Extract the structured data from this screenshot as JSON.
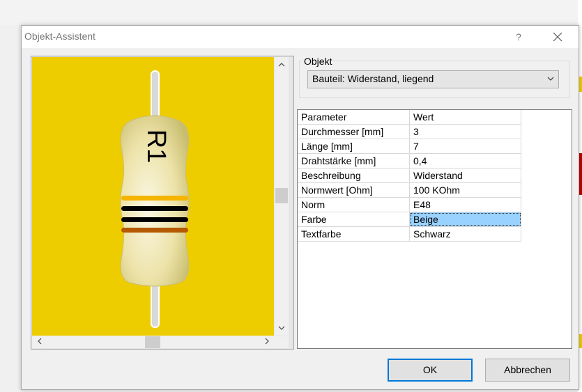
{
  "dialog": {
    "title": "Objekt-Assistent",
    "help_label": "?"
  },
  "preview": {
    "label_text": "R1",
    "body_color": "#f2e9b0",
    "background_color": "#eecd00",
    "band_colors": [
      "#f5b400",
      "#000000",
      "#000000",
      "#b55a00"
    ]
  },
  "objekt": {
    "group_label": "Objekt",
    "selected": "Bauteil: Widerstand, liegend"
  },
  "grid": {
    "header": {
      "param": "Parameter",
      "value": "Wert"
    },
    "rows": [
      {
        "param": "Durchmesser [mm]",
        "value": "3"
      },
      {
        "param": "Länge [mm]",
        "value": "7"
      },
      {
        "param": "Drahtstärke [mm]",
        "value": "0,4"
      },
      {
        "param": "Beschreibung",
        "value": "Widerstand"
      },
      {
        "param": "Normwert [Ohm]",
        "value": "100 KOhm"
      },
      {
        "param": "Norm",
        "value": "E48"
      },
      {
        "param": "Farbe",
        "value": "Beige",
        "selected": true
      },
      {
        "param": "Textfarbe",
        "value": "Schwarz"
      }
    ]
  },
  "buttons": {
    "ok": "OK",
    "cancel": "Abbrechen"
  },
  "icons": {
    "close": "close-icon",
    "scroll_up": "chevron-up-icon",
    "scroll_down": "chevron-down-icon",
    "scroll_left": "chevron-left-icon",
    "scroll_right": "chevron-right-icon",
    "dropdown": "chevron-down-icon"
  }
}
